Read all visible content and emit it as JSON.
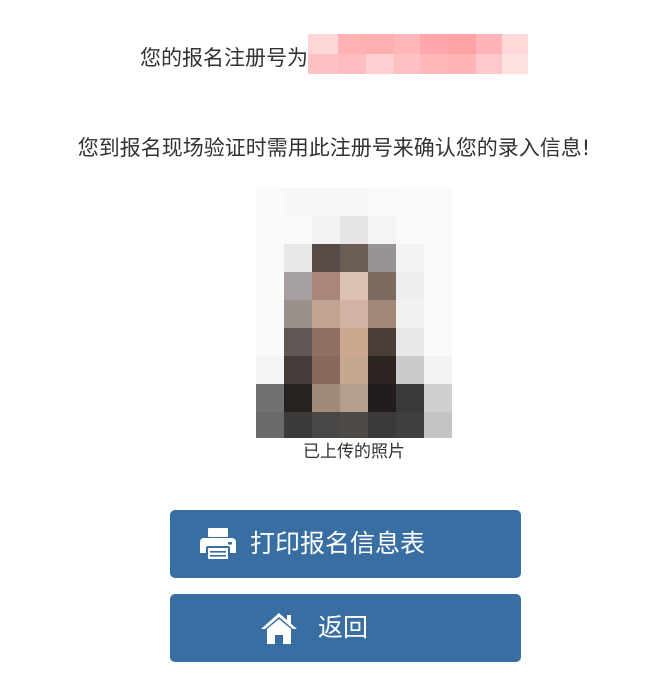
{
  "registration": {
    "label": "您的报名注册号为",
    "number_redacted": true
  },
  "notice": "您到报名现场验证时需用此注册号来确认您的录入信息!",
  "photo": {
    "caption": "已上传的照片",
    "redacted": true
  },
  "buttons": {
    "print": {
      "label": "打印报名信息表",
      "icon": "printer-icon"
    },
    "back": {
      "label": "返回",
      "icon": "home-icon"
    }
  },
  "colors": {
    "button_bg": "#386ea1",
    "button_text": "#ffffff",
    "text": "#333333",
    "redaction": "#ffb0b3"
  }
}
